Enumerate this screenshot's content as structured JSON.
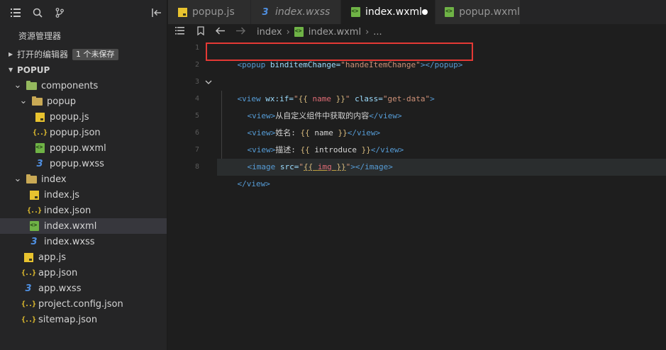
{
  "sidebar": {
    "title": "资源管理器",
    "open_editors": {
      "label": "打开的编辑器",
      "badge": "1 个未保存"
    },
    "project": {
      "label": "POPUP"
    },
    "tree": [
      {
        "label": "components",
        "type": "folder-comp",
        "depth": 1,
        "expanded": true
      },
      {
        "label": "popup",
        "type": "folder",
        "depth": 2,
        "expanded": true
      },
      {
        "label": "popup.js",
        "type": "js",
        "depth": 3
      },
      {
        "label": "popup.json",
        "type": "json",
        "depth": 3
      },
      {
        "label": "popup.wxml",
        "type": "wxml",
        "depth": 3
      },
      {
        "label": "popup.wxss",
        "type": "wxss",
        "depth": 3
      },
      {
        "label": "index",
        "type": "folder",
        "depth": 1,
        "expanded": true
      },
      {
        "label": "index.js",
        "type": "js",
        "depth": 2
      },
      {
        "label": "index.json",
        "type": "json",
        "depth": 2
      },
      {
        "label": "index.wxml",
        "type": "wxml",
        "depth": 2,
        "selected": true
      },
      {
        "label": "index.wxss",
        "type": "wxss",
        "depth": 2
      },
      {
        "label": "app.js",
        "type": "js",
        "depth": 1
      },
      {
        "label": "app.json",
        "type": "json",
        "depth": 1
      },
      {
        "label": "app.wxss",
        "type": "wxss",
        "depth": 1
      },
      {
        "label": "project.config.json",
        "type": "json",
        "depth": 1
      },
      {
        "label": "sitemap.json",
        "type": "json",
        "depth": 1
      }
    ]
  },
  "tabs": [
    {
      "label": "popup.js",
      "type": "js"
    },
    {
      "label": "index.wxss",
      "type": "wxss",
      "italic": true
    },
    {
      "label": "index.wxml",
      "type": "wxml",
      "active": true,
      "dirty": true
    },
    {
      "label": "popup.wxml",
      "type": "wxml"
    }
  ],
  "breadcrumb": {
    "folder": "index",
    "file": "index.wxml",
    "more": "..."
  },
  "editor": {
    "line_numbers": [
      "1",
      "2",
      "3",
      "4",
      "5",
      "6",
      "7",
      "8"
    ],
    "line1": {
      "open": "<popup",
      "attr": " binditemChange=",
      "val": "\"handeItemChange\"",
      "close": "></popup>"
    },
    "line3": {
      "open": "<view",
      "attr1": " wx:if=",
      "q1": "\"",
      "m1": "{{ ",
      "var": "name",
      "m2": " }}",
      "q2": "\"",
      "attr2": " class=",
      "val2": "\"get-data\"",
      "close": ">"
    },
    "line4": {
      "open": "<view>",
      "text": "从自定义组件中获取的内容",
      "close": "</view>"
    },
    "line5": {
      "open": "<view>",
      "text": "姓名: ",
      "m1": "{{ ",
      "var": "name",
      "m2": " }}",
      "close": "</view>"
    },
    "line6": {
      "open": "<view>",
      "text": "描述: ",
      "m1": "{{ ",
      "var": "introduce",
      "m2": " }}",
      "close": "</view>"
    },
    "line7": {
      "open": "<image",
      "attr": " src=",
      "q1": "\"",
      "m1": "{{ ",
      "var": "img",
      "m2": " }}",
      "q2": "\"",
      "close": "></image>"
    },
    "line8": {
      "close": "</view>"
    }
  },
  "colors": {
    "highlight_box": "#e53935",
    "accent_folder": "#c9a955",
    "wxml_icon": "#6fb346",
    "js_icon": "#e8c32f",
    "wxss_icon": "#4f8fe0"
  }
}
